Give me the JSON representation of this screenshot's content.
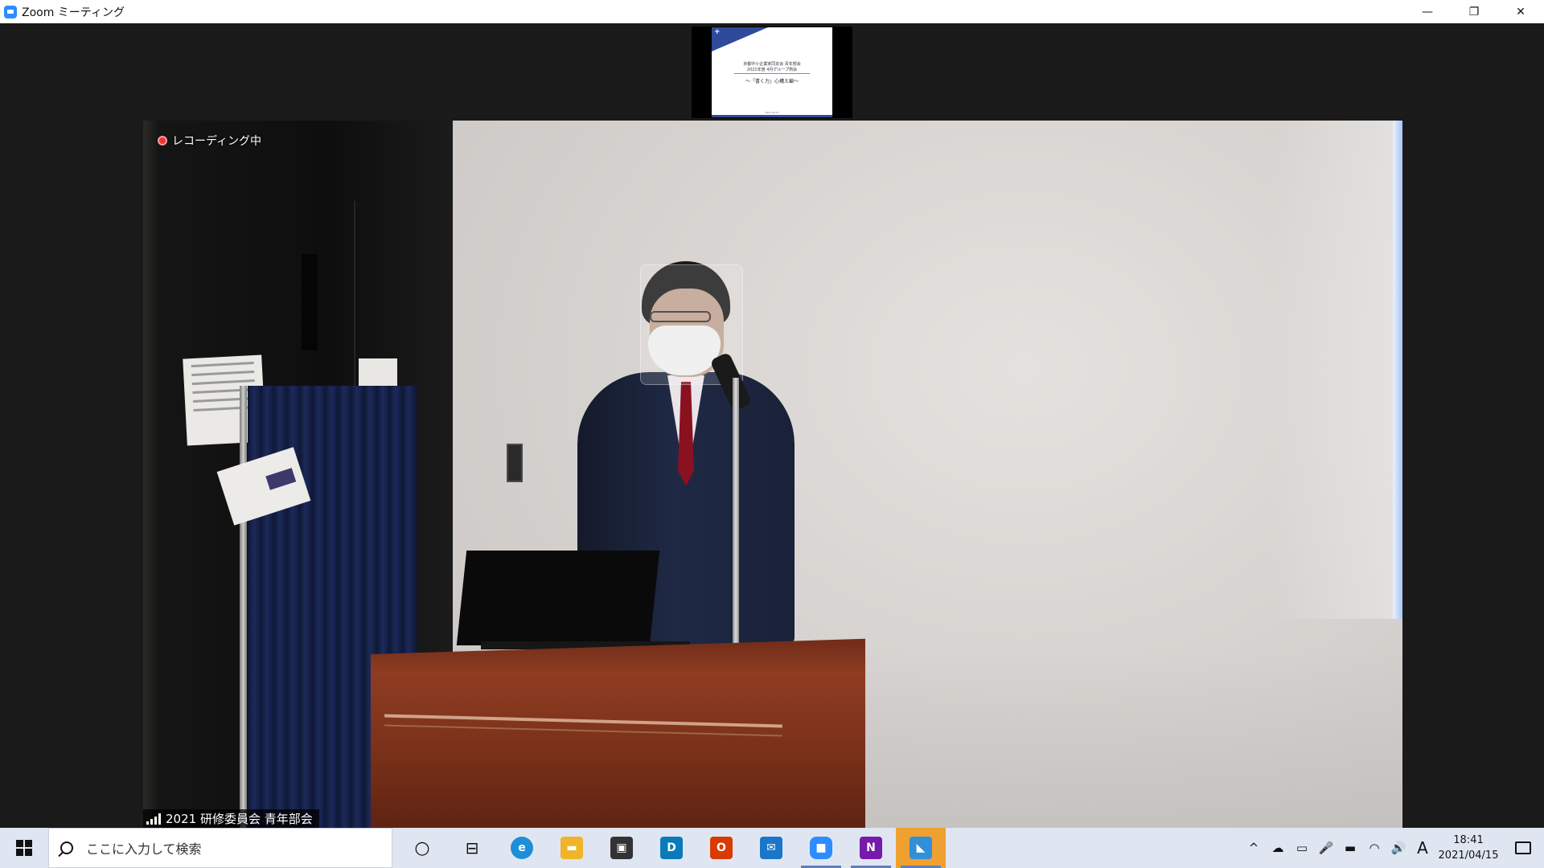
{
  "window": {
    "title": "Zoom ミーティング",
    "controls": {
      "minimize": "—",
      "restore": "❐",
      "close": "✕"
    }
  },
  "thumbnail": {
    "slide_line1": "京都中小企業家同友会 青年部会",
    "slide_line2": "2021年度 4月グループ例会",
    "slide_line3": "〜「書く力」心構え編〜",
    "slide_date": "2021.04.15"
  },
  "video": {
    "recording_label": "レコーディング中",
    "participant_name": "2021 研修委員会 青年部会"
  },
  "taskbar": {
    "search_placeholder": "ここに入力して検索",
    "apps": [
      {
        "name": "cortana-icon",
        "glyph": "○"
      },
      {
        "name": "task-view-icon",
        "glyph": "⊟"
      },
      {
        "name": "edge-icon",
        "glyph": "e",
        "color": "#1d8fd8"
      },
      {
        "name": "file-explorer-icon",
        "glyph": "▬",
        "color": "#f0b429"
      },
      {
        "name": "store-icon",
        "glyph": "▣",
        "color": "#333333"
      },
      {
        "name": "dell-icon",
        "glyph": "D",
        "color": "#0a7bb8"
      },
      {
        "name": "office-icon",
        "glyph": "O",
        "color": "#d83b01"
      },
      {
        "name": "mail-icon",
        "glyph": "✉",
        "color": "#1b75c9"
      },
      {
        "name": "zoom-icon",
        "glyph": "■",
        "color": "#2d8cff"
      },
      {
        "name": "onenote-icon",
        "glyph": "N",
        "color": "#7719aa"
      },
      {
        "name": "photos-icon",
        "glyph": "◣",
        "color": "#2f8fd8"
      }
    ],
    "tray": {
      "chevron": "^",
      "cloud": "☁",
      "meet": "▭",
      "mic": "🎤",
      "battery": "▬",
      "wifi": "◠",
      "volume": "🔊",
      "ime": "A"
    },
    "clock": {
      "time": "18:41",
      "date": "2021/04/15"
    }
  }
}
